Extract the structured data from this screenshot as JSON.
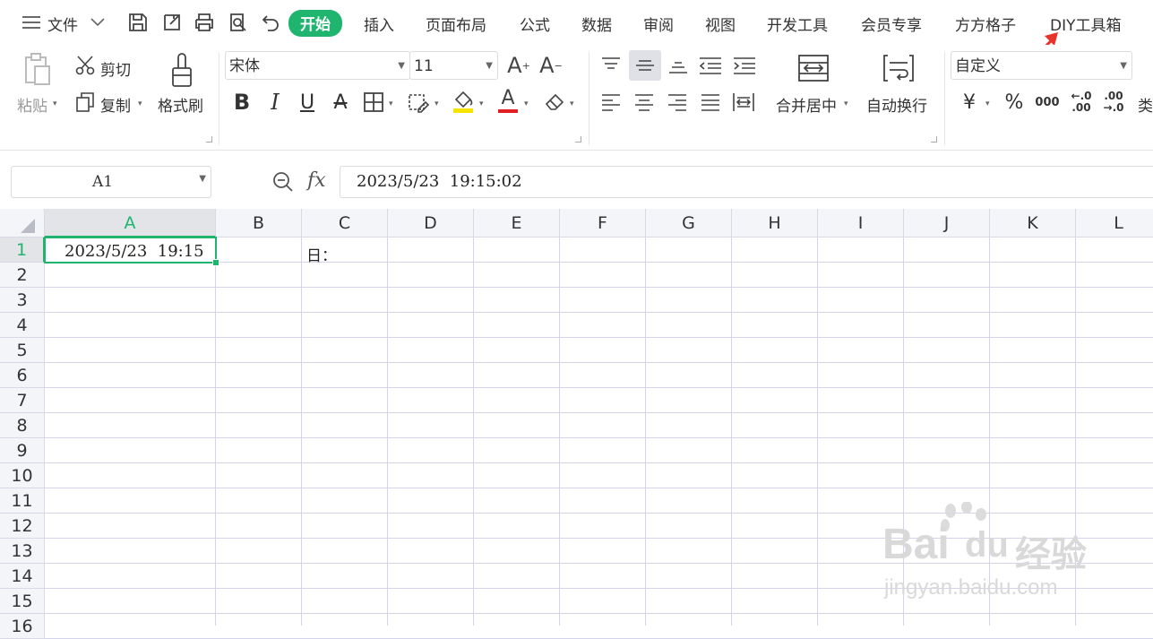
{
  "menubar": {
    "file_label": "文件",
    "tabs": [
      "开始",
      "插入",
      "页面布局",
      "公式",
      "数据",
      "审阅",
      "视图",
      "开发工具",
      "会员专享",
      "方方格子",
      "DIY工具箱"
    ],
    "active_tab": "开始",
    "accent_color": "#1fb56f",
    "arrow_color": "#e8332a"
  },
  "ribbon": {
    "paste_label": "粘贴",
    "cut_label": "剪切",
    "copy_label": "复制",
    "format_painter_label": "格式刷",
    "font_name": "宋体",
    "font_size": "11",
    "bold_glyph": "B",
    "italic_glyph": "I",
    "underline_glyph": "U",
    "strike_glyph": "A",
    "font_color_glyph": "A",
    "grow_glyph": "A",
    "shrink_glyph": "A",
    "merge_label": "合并居中",
    "wrap_label": "自动换行",
    "number_format": "自定义",
    "currency_glyph": "¥",
    "percent_glyph": "%",
    "thousands_glyph": "000",
    "inc_dec_top": "←.0",
    "inc_dec_bottom": ".00",
    "dec_dec_top": ".00",
    "dec_dec_bottom": "→.0",
    "type_partial": "类"
  },
  "formula_bar": {
    "name_box": "A1",
    "fx": "fx",
    "content": "2023/5/23  19:15:02"
  },
  "sheet": {
    "columns": [
      "A",
      "B",
      "C",
      "D",
      "E",
      "F",
      "G",
      "H",
      "I",
      "J",
      "K",
      "L"
    ],
    "rows": [
      "1",
      "2",
      "3",
      "4",
      "5",
      "6",
      "7",
      "8",
      "9",
      "10",
      "11",
      "12",
      "13",
      "14",
      "15",
      "16"
    ],
    "selected_cell": "A1",
    "cells": {
      "A1": "2023/5/23  19:15",
      "C1": "日："
    }
  },
  "watermark": {
    "brand": "Bai",
    "brand2": "du",
    "cn": "经验",
    "url": "jingyan.baidu.com"
  }
}
